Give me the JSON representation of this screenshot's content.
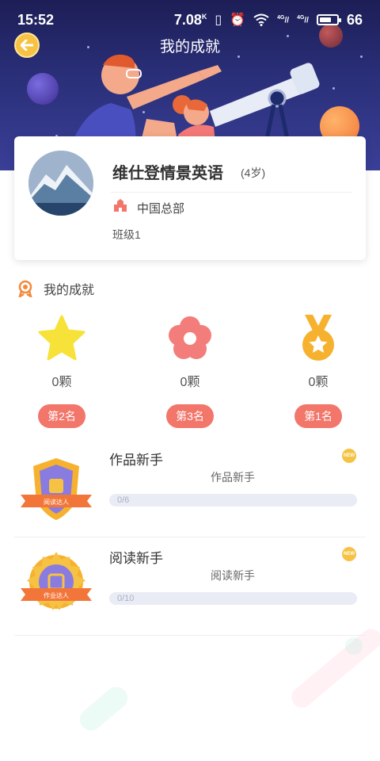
{
  "status_bar": {
    "time": "15:52",
    "speed": "7.08",
    "speed_unit": "K",
    "network_1": "4G",
    "network_2": "4G",
    "battery": "66"
  },
  "header": {
    "title": "我的成就"
  },
  "profile": {
    "name": "维仕登情景英语",
    "age": "(4岁)",
    "org": "中国总部",
    "class": "班级1"
  },
  "achievements": {
    "title": "我的成就",
    "stats": [
      {
        "icon": "star-icon",
        "count": "0颗",
        "rank": "第2名",
        "color": "#f7e23a"
      },
      {
        "icon": "flower-icon",
        "count": "0颗",
        "rank": "第3名",
        "color": "#f37d7a"
      },
      {
        "icon": "medal-icon",
        "count": "0颗",
        "rank": "第1名",
        "color": "#f6b12f"
      }
    ]
  },
  "badges": [
    {
      "name": "作品新手",
      "desc": "作品新手",
      "badge_text": "阅读达人",
      "new_label": "NEW",
      "progress_text": "0/6",
      "progress": 0
    },
    {
      "name": "阅读新手",
      "desc": "阅读新手",
      "badge_text": "作业达人",
      "new_label": "NEW",
      "progress_text": "0/10",
      "progress": 0
    }
  ],
  "colors": {
    "accent": "#f2766a",
    "gold": "#f6c244",
    "hero_dark": "#1d1e56"
  }
}
